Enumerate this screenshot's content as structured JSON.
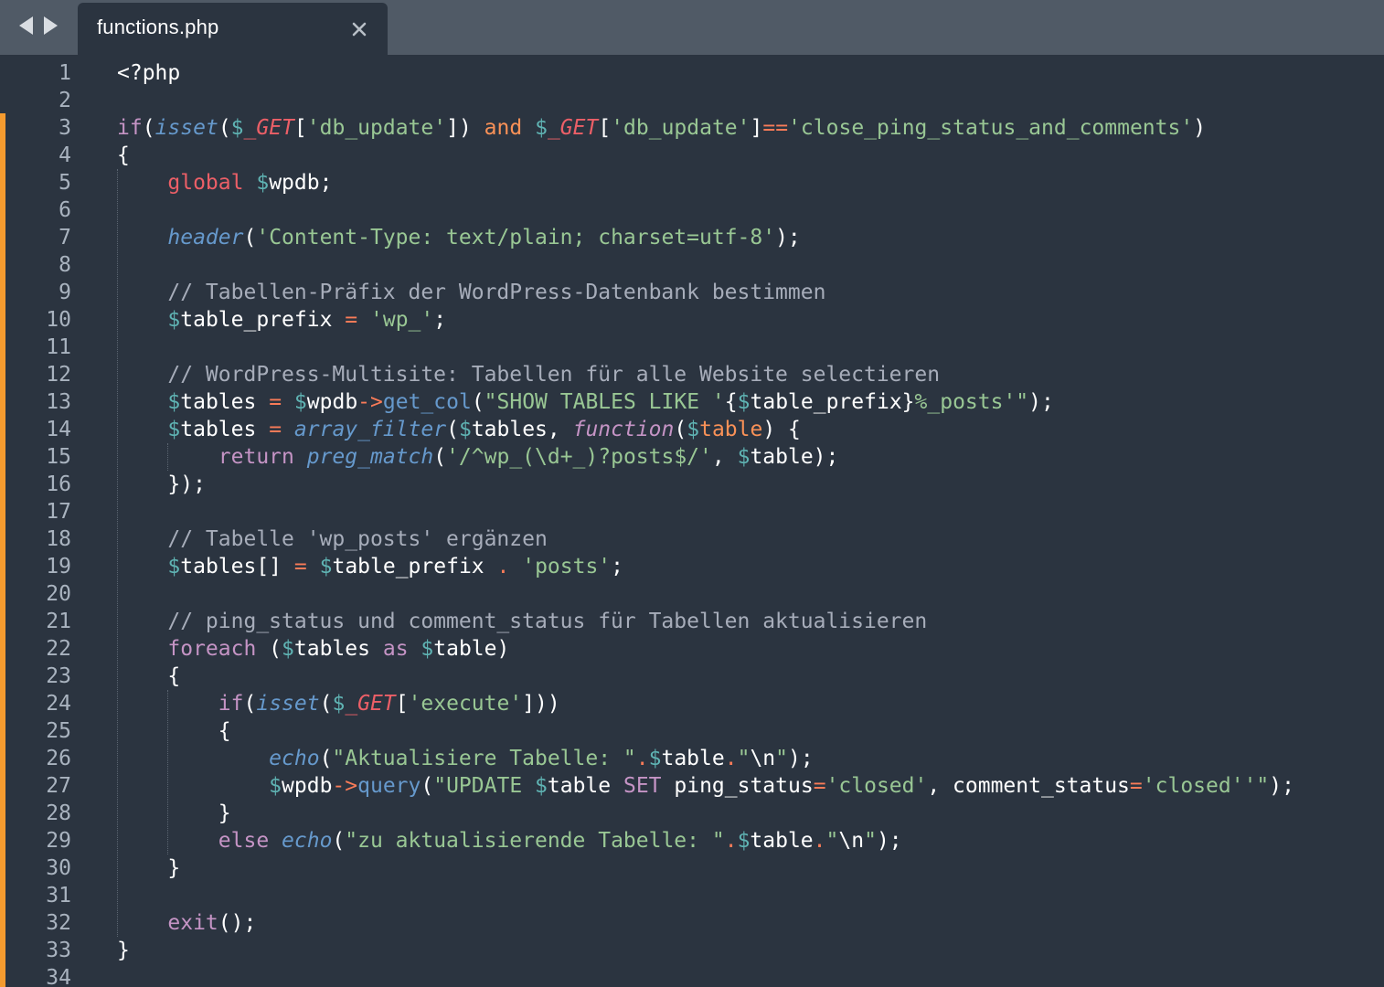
{
  "tabbar": {
    "back_icon": "triangle-left-icon",
    "forward_icon": "triangle-right-icon",
    "tab": {
      "label": "functions.php",
      "close_icon": "close-icon"
    }
  },
  "editor": {
    "language": "php",
    "modified_marker_color": "#f59b2f",
    "lines": [
      [
        [
          "<?php",
          "white"
        ]
      ],
      [],
      [
        [
          "if",
          "kw"
        ],
        [
          "(",
          "white"
        ],
        [
          "isset",
          "fn"
        ],
        [
          "(",
          "white"
        ],
        [
          "$",
          "var"
        ],
        [
          "_GET",
          "red-it"
        ],
        [
          "[",
          "white"
        ],
        [
          "'db_update'",
          "str"
        ],
        [
          "])",
          "white"
        ],
        [
          " ",
          "white"
        ],
        [
          "and",
          "orange"
        ],
        [
          " ",
          "white"
        ],
        [
          "$",
          "var"
        ],
        [
          "_GET",
          "red-it"
        ],
        [
          "[",
          "white"
        ],
        [
          "'db_update'",
          "str"
        ],
        [
          "]",
          "white"
        ],
        [
          "==",
          "op"
        ],
        [
          "'close_ping_status_and_comments'",
          "str"
        ],
        [
          ")",
          "white"
        ]
      ],
      [
        [
          "{",
          "white"
        ]
      ],
      [
        [
          "    ",
          "white"
        ],
        [
          "global",
          "red"
        ],
        [
          " ",
          "white"
        ],
        [
          "$",
          "var"
        ],
        [
          "wpdb;",
          "white"
        ]
      ],
      [],
      [
        [
          "    ",
          "white"
        ],
        [
          "header",
          "fn"
        ],
        [
          "(",
          "white"
        ],
        [
          "'Content-Type: text/plain; charset=utf-8'",
          "str"
        ],
        [
          ");",
          "white"
        ]
      ],
      [],
      [
        [
          "    ",
          "white"
        ],
        [
          "// Tabellen-Präfix der WordPress-Datenbank bestimmen",
          "cmt"
        ]
      ],
      [
        [
          "    ",
          "white"
        ],
        [
          "$",
          "var"
        ],
        [
          "table_prefix",
          "white"
        ],
        [
          " ",
          "white"
        ],
        [
          "=",
          "op"
        ],
        [
          " ",
          "white"
        ],
        [
          "'wp_'",
          "str"
        ],
        [
          ";",
          "white"
        ]
      ],
      [],
      [
        [
          "    ",
          "white"
        ],
        [
          "// WordPress-Multisite: Tabellen für alle Website selectieren",
          "cmt"
        ]
      ],
      [
        [
          "    ",
          "white"
        ],
        [
          "$",
          "var"
        ],
        [
          "tables",
          "white"
        ],
        [
          " ",
          "white"
        ],
        [
          "=",
          "op"
        ],
        [
          " ",
          "white"
        ],
        [
          "$",
          "var"
        ],
        [
          "wpdb",
          "white"
        ],
        [
          "->",
          "op"
        ],
        [
          "get_col",
          "blue"
        ],
        [
          "(",
          "white"
        ],
        [
          "\"SHOW TABLES LIKE '",
          "str"
        ],
        [
          "{",
          "white"
        ],
        [
          "$",
          "var"
        ],
        [
          "table_prefix",
          "white"
        ],
        [
          "}",
          "white"
        ],
        [
          "%_posts'\"",
          "str"
        ],
        [
          ");",
          "white"
        ]
      ],
      [
        [
          "    ",
          "white"
        ],
        [
          "$",
          "var"
        ],
        [
          "tables",
          "white"
        ],
        [
          " ",
          "white"
        ],
        [
          "=",
          "op"
        ],
        [
          " ",
          "white"
        ],
        [
          "array_filter",
          "fn"
        ],
        [
          "(",
          "white"
        ],
        [
          "$",
          "var"
        ],
        [
          "tables, ",
          "white"
        ],
        [
          "function",
          "kw-it"
        ],
        [
          "(",
          "white"
        ],
        [
          "$",
          "var"
        ],
        [
          "table",
          "orange"
        ],
        [
          ") {",
          "white"
        ]
      ],
      [
        [
          "        ",
          "white"
        ],
        [
          "return",
          "kw"
        ],
        [
          " ",
          "white"
        ],
        [
          "preg_match",
          "fn"
        ],
        [
          "(",
          "white"
        ],
        [
          "'/^wp_(\\d+_)?posts$/'",
          "str"
        ],
        [
          ", ",
          "white"
        ],
        [
          "$",
          "var"
        ],
        [
          "table);",
          "white"
        ]
      ],
      [
        [
          "    ",
          "white"
        ],
        [
          "});",
          "white"
        ]
      ],
      [],
      [
        [
          "    ",
          "white"
        ],
        [
          "// Tabelle 'wp_posts' ergänzen",
          "cmt"
        ]
      ],
      [
        [
          "    ",
          "white"
        ],
        [
          "$",
          "var"
        ],
        [
          "tables[]",
          "white"
        ],
        [
          " ",
          "white"
        ],
        [
          "=",
          "op"
        ],
        [
          " ",
          "white"
        ],
        [
          "$",
          "var"
        ],
        [
          "table_prefix",
          "white"
        ],
        [
          " ",
          "white"
        ],
        [
          ".",
          "op"
        ],
        [
          " ",
          "white"
        ],
        [
          "'posts'",
          "str"
        ],
        [
          ";",
          "white"
        ]
      ],
      [],
      [
        [
          "    ",
          "white"
        ],
        [
          "// ping_status und comment_status für Tabellen aktualisieren",
          "cmt"
        ]
      ],
      [
        [
          "    ",
          "white"
        ],
        [
          "foreach",
          "kw"
        ],
        [
          " (",
          "white"
        ],
        [
          "$",
          "var"
        ],
        [
          "tables",
          "white"
        ],
        [
          " ",
          "white"
        ],
        [
          "as",
          "kw"
        ],
        [
          " ",
          "white"
        ],
        [
          "$",
          "var"
        ],
        [
          "table)",
          "white"
        ]
      ],
      [
        [
          "    ",
          "white"
        ],
        [
          "{",
          "white"
        ]
      ],
      [
        [
          "        ",
          "white"
        ],
        [
          "if",
          "kw"
        ],
        [
          "(",
          "white"
        ],
        [
          "isset",
          "fn"
        ],
        [
          "(",
          "white"
        ],
        [
          "$",
          "var"
        ],
        [
          "_GET",
          "red-it"
        ],
        [
          "[",
          "white"
        ],
        [
          "'execute'",
          "str"
        ],
        [
          "]))",
          "white"
        ]
      ],
      [
        [
          "        ",
          "white"
        ],
        [
          "{",
          "white"
        ]
      ],
      [
        [
          "            ",
          "white"
        ],
        [
          "echo",
          "fn"
        ],
        [
          "(",
          "white"
        ],
        [
          "\"Aktualisiere Tabelle: \"",
          "str"
        ],
        [
          ".",
          "op"
        ],
        [
          "$",
          "var"
        ],
        [
          "table",
          "white"
        ],
        [
          ".",
          "op"
        ],
        [
          "\"",
          "str"
        ],
        [
          "\\n",
          "white"
        ],
        [
          "\"",
          "str"
        ],
        [
          ");",
          "white"
        ]
      ],
      [
        [
          "            ",
          "white"
        ],
        [
          "$",
          "var"
        ],
        [
          "wpdb",
          "white"
        ],
        [
          "->",
          "op"
        ],
        [
          "query",
          "blue"
        ],
        [
          "(",
          "white"
        ],
        [
          "\"UPDATE ",
          "str"
        ],
        [
          "$",
          "var"
        ],
        [
          "table",
          "white"
        ],
        [
          " SET ",
          "kw"
        ],
        [
          "ping_status",
          "white"
        ],
        [
          "=",
          "op"
        ],
        [
          "'closed'",
          "str"
        ],
        [
          ", ",
          "white"
        ],
        [
          "comment_status",
          "white"
        ],
        [
          "=",
          "op"
        ],
        [
          "'closed'",
          "str"
        ],
        [
          "'\"",
          "str"
        ],
        [
          ");",
          "white"
        ]
      ],
      [
        [
          "        ",
          "white"
        ],
        [
          "}",
          "white"
        ]
      ],
      [
        [
          "        ",
          "white"
        ],
        [
          "else",
          "kw"
        ],
        [
          " ",
          "white"
        ],
        [
          "echo",
          "fn"
        ],
        [
          "(",
          "white"
        ],
        [
          "\"zu aktualisierende Tabelle: \"",
          "str"
        ],
        [
          ".",
          "op"
        ],
        [
          "$",
          "var"
        ],
        [
          "table",
          "white"
        ],
        [
          ".",
          "op"
        ],
        [
          "\"",
          "str"
        ],
        [
          "\\n",
          "white"
        ],
        [
          "\"",
          "str"
        ],
        [
          ");",
          "white"
        ]
      ],
      [
        [
          "    ",
          "white"
        ],
        [
          "}",
          "white"
        ]
      ],
      [],
      [
        [
          "    ",
          "white"
        ],
        [
          "exit",
          "kw"
        ],
        [
          "();",
          "white"
        ]
      ],
      [
        [
          "}",
          "white"
        ]
      ],
      []
    ]
  }
}
